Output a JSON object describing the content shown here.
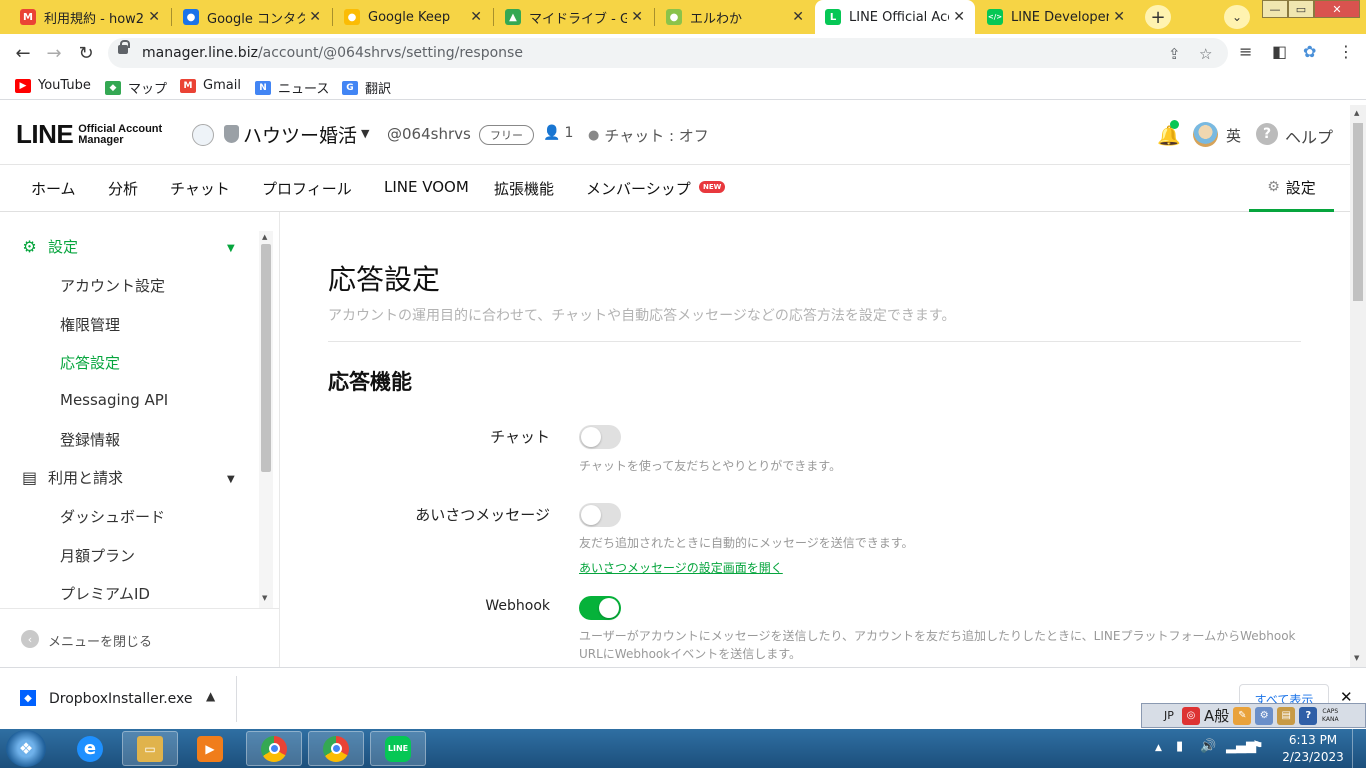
{
  "browser": {
    "tabs": [
      {
        "title": "利用規約 - how2",
        "favicon_color": "#ea4335",
        "favicon_glyph": "M"
      },
      {
        "title": "Google コンタク",
        "favicon_color": "#1a73e8",
        "favicon_glyph": "●"
      },
      {
        "title": "Google Keep",
        "favicon_color": "#fbbc04",
        "favicon_glyph": "●"
      },
      {
        "title": "マイドライブ - G",
        "favicon_color": "#34a853",
        "favicon_glyph": "▲"
      },
      {
        "title": "エルわか",
        "favicon_color": "#8bc34a",
        "favicon_glyph": "●"
      },
      {
        "title": "LINE Official Acc",
        "favicon_color": "#06c755",
        "favicon_glyph": "L",
        "active": true
      },
      {
        "title": "LINE Developers",
        "favicon_color": "#06c755",
        "favicon_glyph": "</>"
      }
    ],
    "new_tab": "+",
    "tab_menu": "⌄",
    "window_controls": {
      "minimize": "—",
      "maximize": "▭",
      "close": "✕"
    },
    "url_host": "manager.line.biz",
    "url_path": "/account/@064shrvs/setting/response",
    "bookmarks": [
      {
        "label": "YouTube",
        "color": "#ff0000",
        "glyph": "▶"
      },
      {
        "label": "マップ",
        "color": "#34a853",
        "glyph": "◆"
      },
      {
        "label": "Gmail",
        "color": "#ea4335",
        "glyph": "M"
      },
      {
        "label": "ニュース",
        "color": "#4285f4",
        "glyph": "N"
      },
      {
        "label": "翻訳",
        "color": "#4285f4",
        "glyph": "G"
      }
    ]
  },
  "app": {
    "logo_big": "LINE",
    "logo_small_1": "Official Account",
    "logo_small_2": "Manager",
    "account_name": "ハウツー婚活",
    "account_id": "@064shrvs",
    "plan": "フリー",
    "member_count": "1",
    "chat_status": "チャット : オフ",
    "lang": "英",
    "help": "ヘルプ",
    "accent_color": "#06c755",
    "nav": [
      "ホーム",
      "分析",
      "チャット",
      "プロフィール",
      "LINE VOOM",
      "拡張機能",
      "メンバーシップ"
    ],
    "nav_new_badge": "NEW",
    "nav_settings": "設定"
  },
  "sidebar": {
    "section1": {
      "label": "設定",
      "icon": "gear-icon"
    },
    "section1_items": [
      "アカウント設定",
      "権限管理",
      "応答設定",
      "Messaging API",
      "登録情報"
    ],
    "section1_active_index": 2,
    "section2": {
      "label": "利用と請求",
      "icon": "document-icon"
    },
    "section2_items": [
      "ダッシュボード",
      "月額プラン",
      "プレミアムID"
    ],
    "close_menu": "メニューを閉じる"
  },
  "content": {
    "title": "応答設定",
    "description": "アカウントの運用目的に合わせて、チャットや自動応答メッセージなどの応答方法を設定できます。",
    "section_title": "応答機能",
    "rows": [
      {
        "label": "チャット",
        "enabled": false,
        "help": "チャットを使って友だちとやりとりができます。"
      },
      {
        "label": "あいさつメッセージ",
        "enabled": false,
        "help": "友だち追加されたときに自動的にメッセージを送信できます。",
        "link": "あいさつメッセージの設定画面を開く"
      },
      {
        "label": "Webhook",
        "enabled": true,
        "help_1": "ユーザーがアカウントにメッセージを送信したり、アカウントを友だち追加したりしたときに、LINEプラットフォームからWebhook",
        "help_2": "URLにWebhookイベントを送信します。"
      }
    ]
  },
  "download": {
    "filename": "DropboxInstaller.exe",
    "show_all": "すべて表示"
  },
  "ime": {
    "lang": "JP",
    "mode": "A",
    "mode2": "般",
    "caps": "CAPS",
    "kana": "KANA"
  },
  "taskbar": {
    "time": "6:13 PM",
    "date": "2/23/2023"
  }
}
